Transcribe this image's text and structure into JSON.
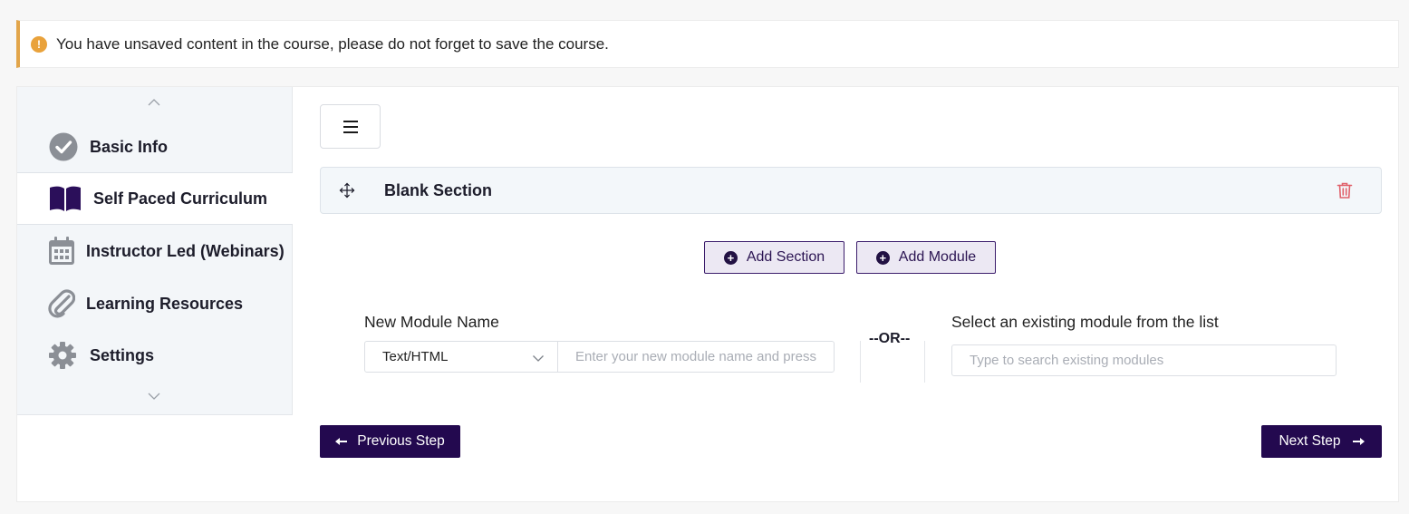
{
  "alert": {
    "icon": "exclamation-circle-icon",
    "message": "You have unsaved content in the course, please do not forget to save the course.",
    "accent_color": "#e2a54a"
  },
  "sidebar": {
    "items": [
      {
        "label": "Basic Info",
        "icon": "check-circle-icon",
        "active": false
      },
      {
        "label": "Self Paced Curriculum",
        "icon": "book-icon",
        "active": true
      },
      {
        "label": "Instructor Led (Webinars)",
        "icon": "calendar-icon",
        "active": false
      },
      {
        "label": "Learning Resources",
        "icon": "paperclip-icon",
        "active": false
      },
      {
        "label": "Settings",
        "icon": "gear-icon",
        "active": false
      }
    ]
  },
  "curriculum": {
    "section": {
      "title": "Blank Section"
    },
    "add_section_label": "Add Section",
    "add_module_label": "Add Module",
    "new_module": {
      "label": "New Module Name",
      "type_value": "Text/HTML",
      "name_placeholder": "Enter your new module name and press"
    },
    "or_text": "--OR--",
    "existing_module": {
      "label": "Select an existing module from the list",
      "search_placeholder": "Type to search existing modules"
    }
  },
  "navigation": {
    "previous_label": "Previous Step",
    "next_label": "Next Step"
  },
  "colors": {
    "primary": "#23094f",
    "secondary_bg": "#ece8f3",
    "delete": "#e0606a",
    "sidebar_bg": "#f3f6f9"
  }
}
